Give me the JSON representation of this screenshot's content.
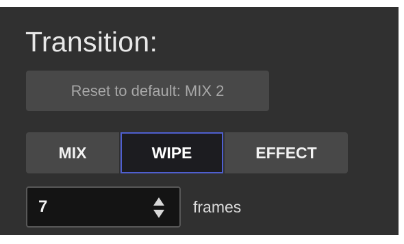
{
  "panel": {
    "title": "Transition:",
    "reset_button_label": "Reset to default: MIX 2",
    "transition_types": [
      {
        "label": "MIX",
        "selected": false
      },
      {
        "label": "WIPE",
        "selected": true
      },
      {
        "label": "EFFECT",
        "selected": false
      }
    ],
    "duration": {
      "value": "7",
      "unit": "frames",
      "stepper_icon": "up-down-arrows-icon"
    }
  },
  "colors": {
    "background": "#303030",
    "button": "#484848",
    "selected_bg": "#1c1c20",
    "selected_border": "#4f5fcf"
  }
}
